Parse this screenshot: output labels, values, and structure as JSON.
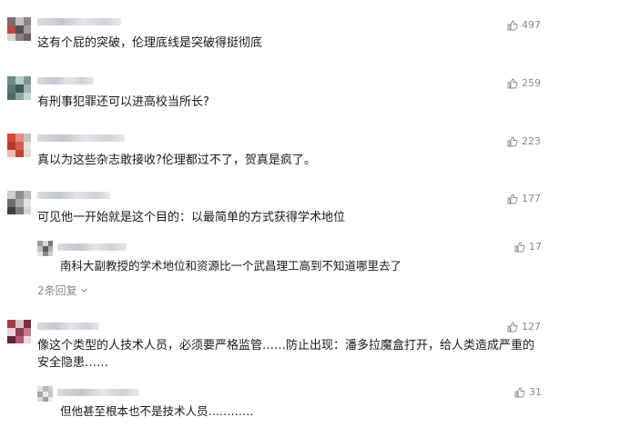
{
  "comments": [
    {
      "text": "这有个屁的突破，伦理底线是突破得挺彻底",
      "likes": "497"
    },
    {
      "text": "有刑事犯罪还可以进高校当所长?",
      "likes": "259"
    },
    {
      "text": "真以为这些杂志敢接收?伦理都过不了，贺真是疯了。",
      "likes": "223"
    },
    {
      "text": "可见他一开始就是这个目的：以最简单的方式获得学术地位",
      "likes": "177",
      "reply": {
        "text": "南科大副教授的学术地位和资源比一个武昌理工高到不知道哪里去了",
        "likes": "17"
      },
      "more_replies": "2条回复"
    },
    {
      "text_line1": "像这个类型的人技术人员，必须要严格监管……防止出现：潘多拉魔盒打开，给人类造成严重的",
      "text_line2": "安全隐患……",
      "likes": "127",
      "reply": {
        "text": "但他甚至根本也不是技术人员…………",
        "likes": "31"
      }
    }
  ],
  "icons": {
    "like": "thumbs-up-icon",
    "chevron": "chevron-down-icon"
  },
  "colors": {
    "text": "#1a1a1a",
    "meta": "#8a8a8a"
  }
}
